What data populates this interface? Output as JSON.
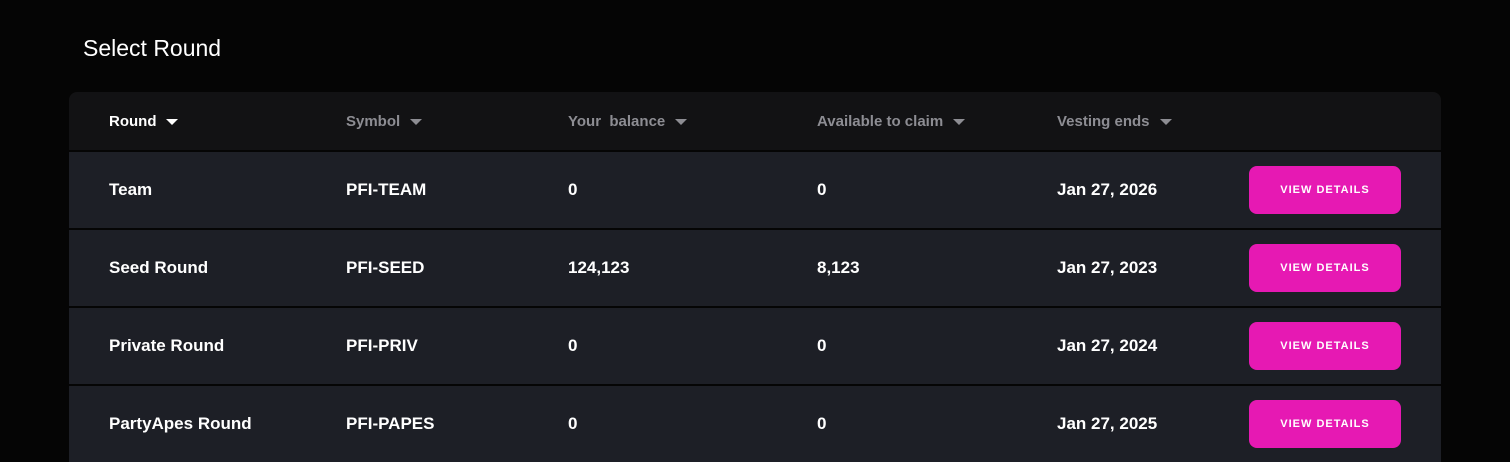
{
  "page": {
    "title": "Select Round"
  },
  "table": {
    "columns": [
      {
        "label": "Round",
        "active": true
      },
      {
        "label": "Symbol",
        "active": false
      },
      {
        "label": "Your  balance",
        "active": false
      },
      {
        "label": "Available to claim",
        "active": false
      },
      {
        "label": "Vesting ends",
        "active": false
      }
    ],
    "rows": [
      {
        "round": "Team",
        "symbol": "PFI-TEAM",
        "balance": "0",
        "available": "0",
        "vesting_ends": "Jan 27, 2026",
        "action_label": "VIEW DETAILS"
      },
      {
        "round": "Seed Round",
        "symbol": "PFI-SEED",
        "balance": "124,123",
        "available": "8,123",
        "vesting_ends": "Jan 27, 2023",
        "action_label": "VIEW DETAILS"
      },
      {
        "round": "Private Round",
        "symbol": "PFI-PRIV",
        "balance": "0",
        "available": "0",
        "vesting_ends": "Jan 27, 2024",
        "action_label": "VIEW DETAILS"
      },
      {
        "round": "PartyApes Round",
        "symbol": "PFI-PAPES",
        "balance": "0",
        "available": "0",
        "vesting_ends": "Jan 27, 2025",
        "action_label": "VIEW DETAILS"
      }
    ]
  },
  "icons": {
    "sort": "caret-down-icon"
  },
  "colors": {
    "background": "#050505",
    "header_bg": "#121214",
    "row_bg": "#1d1f26",
    "accent": "#e619b3",
    "muted_text": "#8d8d93",
    "text": "#ffffff"
  }
}
